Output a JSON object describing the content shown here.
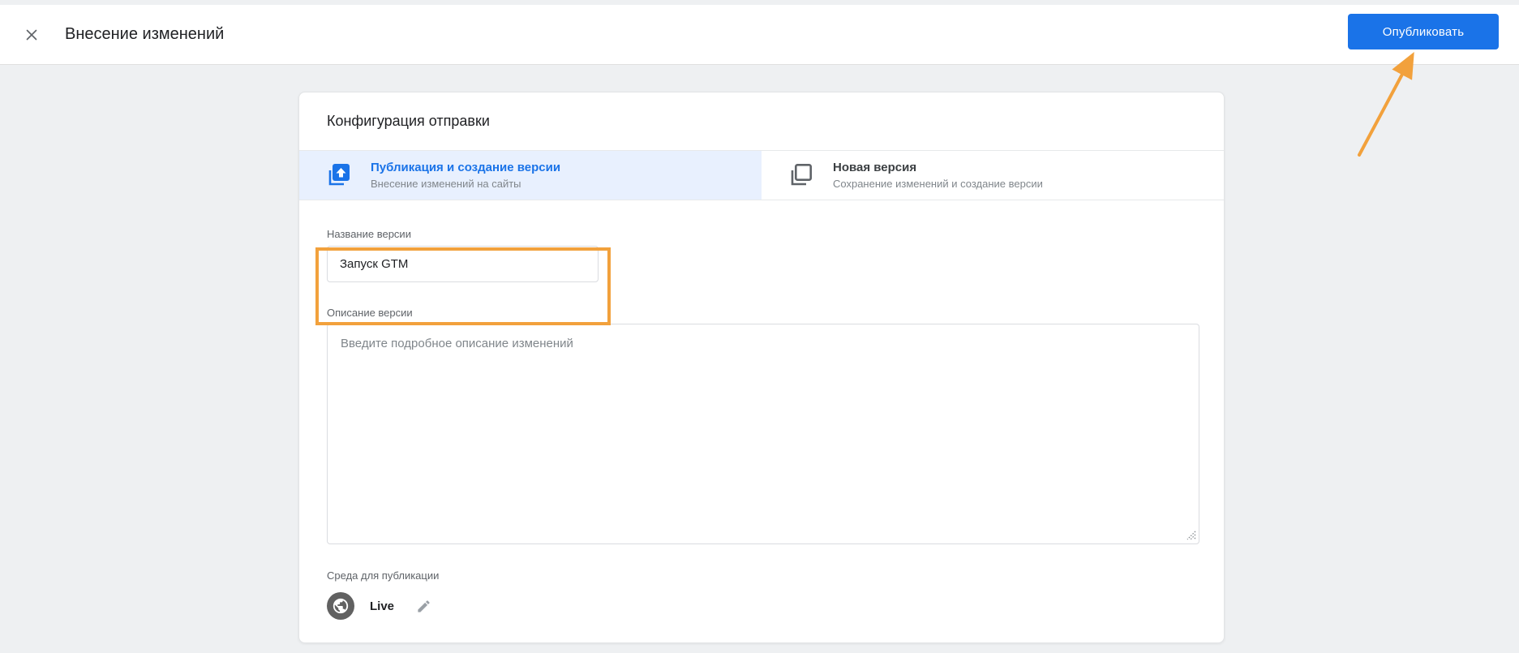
{
  "header": {
    "title": "Внесение изменений",
    "publish_button": "Опубликовать"
  },
  "card": {
    "title": "Конфигурация отправки",
    "tabs": [
      {
        "title": "Публикация и создание версии",
        "subtitle": "Внесение изменений на сайты",
        "selected": true
      },
      {
        "title": "Новая версия",
        "subtitle": "Сохранение изменений и создание версии",
        "selected": false
      }
    ],
    "version_name": {
      "label": "Название версии",
      "value": "Запуск GTM"
    },
    "version_description": {
      "label": "Описание версии",
      "placeholder": "Введите подробное описание изменений"
    },
    "environment": {
      "label": "Среда для публикации",
      "value": "Live"
    }
  },
  "icons": {
    "close": "close-icon",
    "publish_tab": "publish-pages-icon",
    "new_version_tab": "stacked-pages-icon",
    "environment": "globe-icon",
    "edit": "pencil-icon"
  },
  "colors": {
    "accent_blue": "#1a73e8",
    "annotation_orange": "#f2a13c",
    "selected_tab_bg": "#e8f0fe",
    "page_bg": "#eef0f2"
  }
}
